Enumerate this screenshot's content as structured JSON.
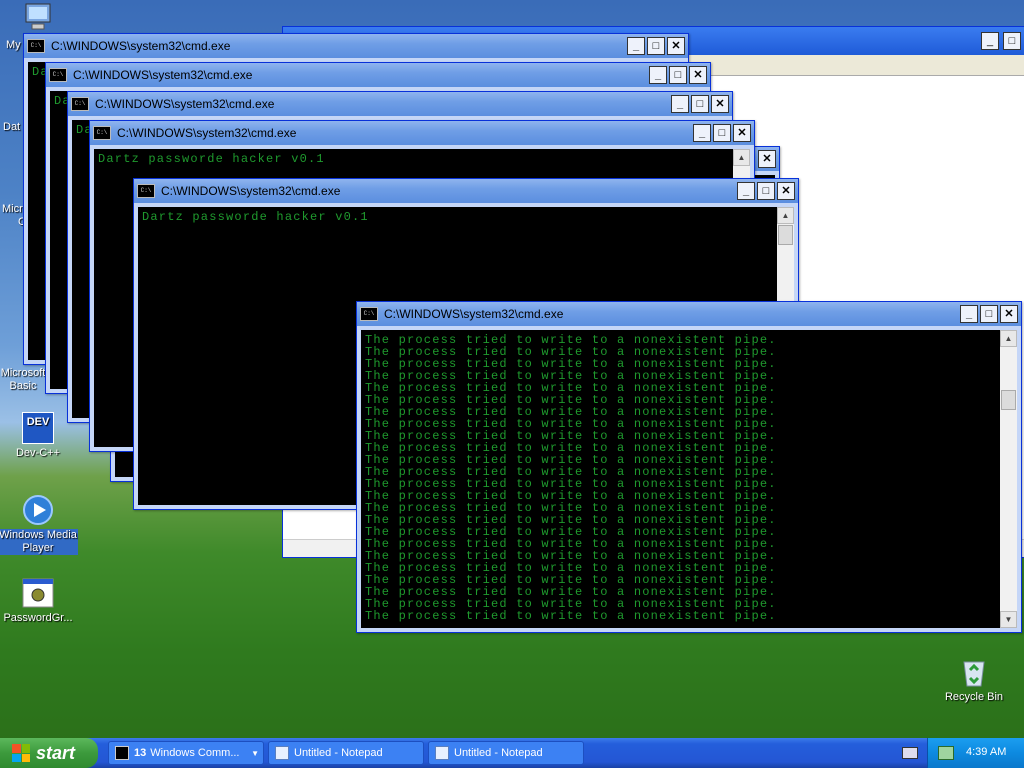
{
  "desktop": {
    "partial_labels": [
      "My",
      "Dat",
      "Micro",
      "C"
    ],
    "icons": [
      {
        "line1": "Microsoft",
        "line2": "Basic"
      },
      {
        "line1": "Dev-C++",
        "line2": ""
      },
      {
        "line1": "Windows Media",
        "line2": "Player"
      },
      {
        "line1": "PasswordGr...",
        "line2": ""
      },
      {
        "line1": "Recycle Bin",
        "line2": ""
      }
    ],
    "devcpp_glyph": "DEV"
  },
  "windows": [
    {
      "title": "C:\\WINDOWS\\system32\\cmd.exe",
      "text": "Da"
    },
    {
      "title": "C:\\WINDOWS\\system32\\cmd.exe",
      "text": "Da"
    },
    {
      "title": "C:\\WINDOWS\\system32\\cmd.exe",
      "text": "Da"
    },
    {
      "title": "C:\\WINDOWS\\system32\\cmd.exe",
      "text": "Dartz passworde hacker v0.1"
    },
    {
      "title": "C:\\WINDOWS\\system32\\cmd.exe",
      "text": "Dartz passworde hacker v0.1"
    },
    {
      "title": "C:\\WINDOWS\\system32\\cmd.exe",
      "line": "The process tried to write to a nonexistent pipe.",
      "line_count": 24
    }
  ],
  "controls": {
    "minimize": "_",
    "maximize": "□",
    "close": "✕",
    "cmd_icon": "C:\\"
  },
  "taskbar": {
    "start_label": "start",
    "buttons": [
      {
        "count": "13",
        "label": "Windows Comm..."
      },
      {
        "label": "Untitled - Notepad"
      },
      {
        "label": "Untitled - Notepad"
      }
    ],
    "clock": "4:39 AM"
  },
  "colors": {
    "console_text": "#1f9a2e",
    "titlebar": "#6f9ee6",
    "taskbar": "#245edb"
  }
}
